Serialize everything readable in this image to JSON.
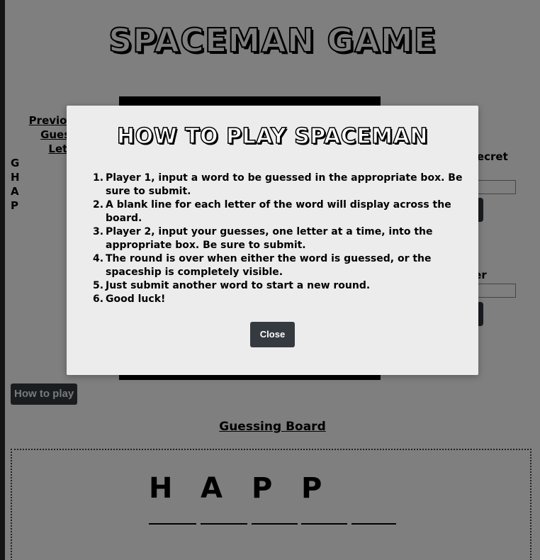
{
  "title": "SPACEMAN GAME",
  "previous": {
    "heading": "Previously Guessed Letters",
    "letters": [
      "G",
      "H",
      "A",
      "P"
    ]
  },
  "side": {
    "secret_label": "secret",
    "letter_label": "ter"
  },
  "how_to_button": "How to play",
  "guessing": {
    "heading": "Guessing Board",
    "slots": [
      "H",
      "A",
      "P",
      "P",
      ""
    ]
  },
  "modal": {
    "title": "HOW TO PLAY SPACEMAN",
    "steps": [
      {
        "num": "1.",
        "text": "Player 1, input a word to be guessed in the appropriate box. Be sure to submit."
      },
      {
        "num": "2.",
        "text": "A blank line for each letter of the word will display across the board."
      },
      {
        "num": "3.",
        "text": "Player 2, input your guesses, one letter at a time, into the appropriate box. Be sure to submit."
      },
      {
        "num": "4.",
        "text": "The round is over when either the word is guessed, or the spaceship is completely visible."
      },
      {
        "num": "5.",
        "text": "Just submit another word to start a new round."
      },
      {
        "num": "6.",
        "text": "Good luck!"
      }
    ],
    "close_label": "Close"
  }
}
